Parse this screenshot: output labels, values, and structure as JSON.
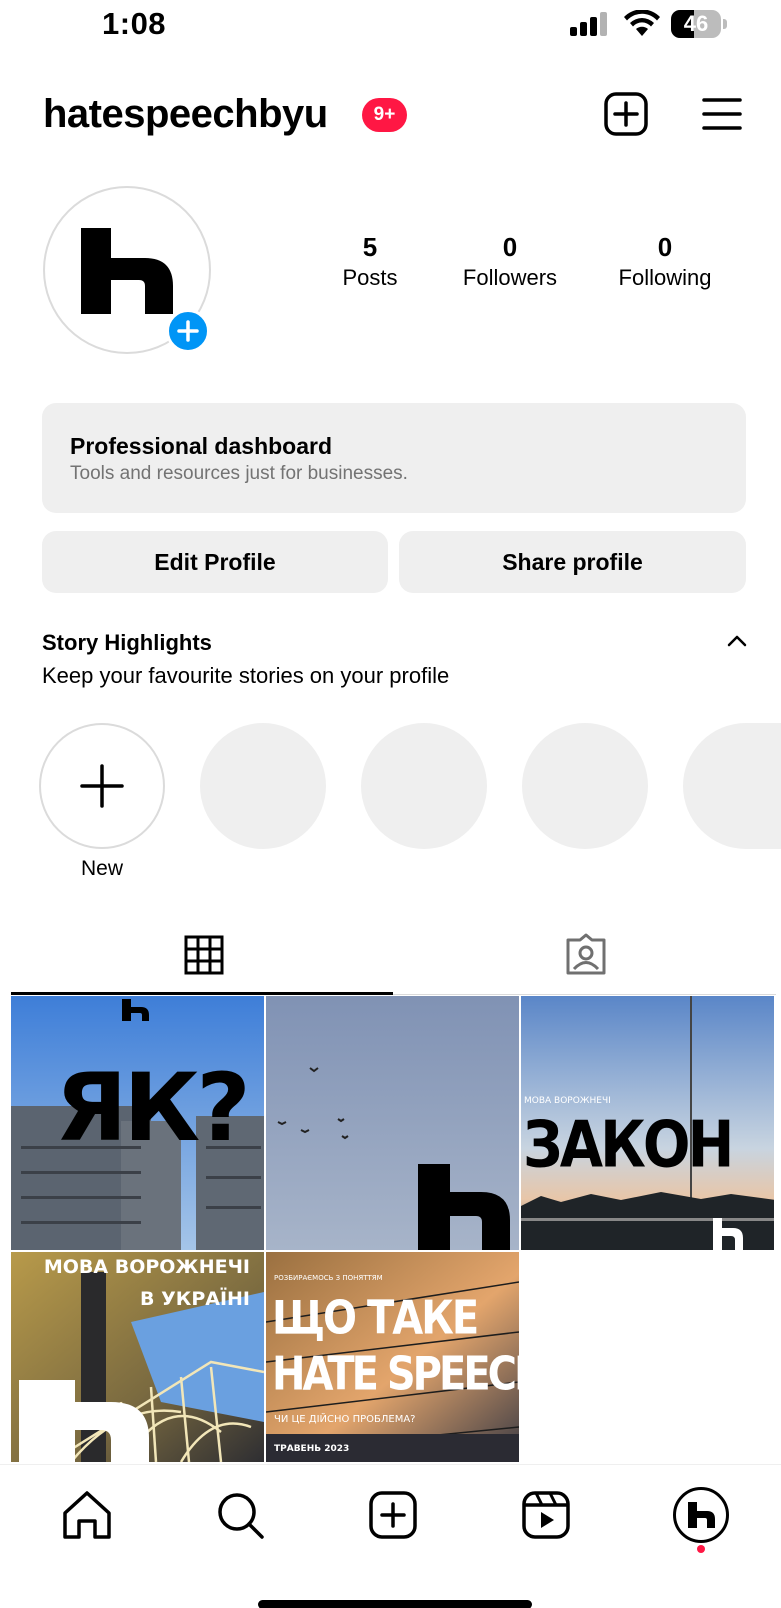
{
  "status_bar": {
    "time": "1:08",
    "battery": "46",
    "battery_level_percent": 46
  },
  "header": {
    "username": "hatespeechbyu",
    "notification_badge": "9+"
  },
  "profile": {
    "stats": [
      {
        "value": "5",
        "label": "Posts"
      },
      {
        "value": "0",
        "label": "Followers"
      },
      {
        "value": "0",
        "label": "Following"
      }
    ]
  },
  "dashboard": {
    "title": "Professional dashboard",
    "subtitle": "Tools and resources just for businesses."
  },
  "buttons": {
    "edit": "Edit Profile",
    "share": "Share profile"
  },
  "highlights": {
    "title": "Story Highlights",
    "subtitle": "Keep your favourite stories on your profile",
    "new_label": "New"
  },
  "posts": [
    {
      "text": "ЯК?"
    },
    {
      "text": ""
    },
    {
      "small_text": "МОВА ВОРОЖНЕЧІ",
      "text": "ЗАКОН"
    },
    {
      "line1": "МОВА ВОРОЖНЕЧІ",
      "line2": "В УКРАЇНІ"
    },
    {
      "kicker": "РОЗБИРАЄМОСЬ З ПОНЯТТЯМ",
      "line1": "ЩО ТАКЕ",
      "line2": "HATE SPEECH",
      "sub": "ЧИ ЦЕ ДІЙСНО ПРОБЛЕМА?",
      "date": "ТРАВЕНЬ 2023"
    }
  ],
  "icons": {
    "header": [
      "add-post-icon",
      "menu-icon"
    ],
    "tabs": [
      "grid-icon",
      "tagged-icon"
    ],
    "nav": [
      "home-icon",
      "search-icon",
      "create-icon",
      "reels-icon",
      "profile-icon"
    ]
  },
  "colors": {
    "accent_blue": "#0095f6",
    "badge_red": "#ff1744",
    "panel_gray": "#efefef"
  }
}
